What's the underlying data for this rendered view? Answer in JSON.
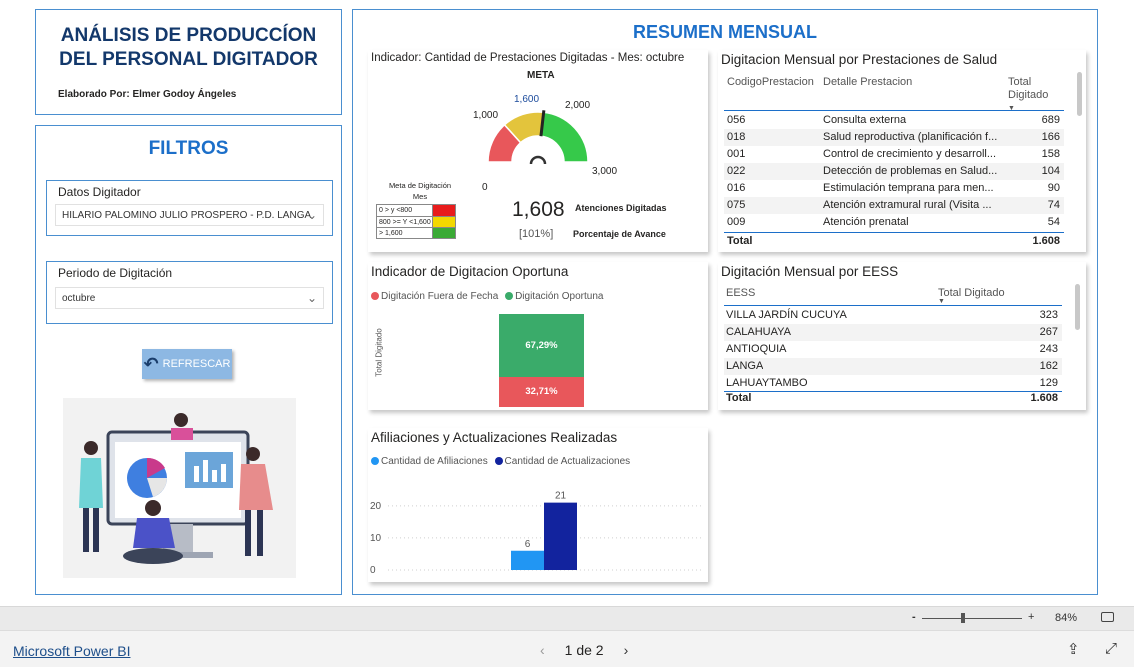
{
  "report": {
    "title_line1": "ANÁLISIS DE PRODUCCÍON",
    "title_line2": "DEL PERSONAL DIGITADOR",
    "author": "Elaborado Por: Elmer Godoy Ángeles"
  },
  "filters": {
    "title": "FILTROS",
    "digitador_label": "Datos Digitador",
    "digitador_value": "HILARIO PALOMINO JULIO PROSPERO - P.D. LANGA",
    "periodo_label": "Periodo de Digitación",
    "periodo_value": "octubre",
    "refresh_label": "REFRESCAR"
  },
  "summary": {
    "title": "RESUMEN MENSUAL"
  },
  "gauge": {
    "title": "Indicador: Cantidad de Prestaciones Digitadas - Mes: octubre",
    "meta_label": "META",
    "target_label": "1,600",
    "tick_min": "0",
    "tick_1000": "1,000",
    "tick_2000": "2,000",
    "tick_max": "3,000",
    "value": 1608,
    "value_label": "1,608",
    "value_caption": "Atenciones Digitadas",
    "percent_label": "[101%]",
    "percent_caption": "Porcentaje de Avance",
    "max": 3000,
    "target": 1600,
    "legend_title": "Meta de Digitación Mes",
    "legend_rows": [
      {
        "label": "0 > y <800",
        "color": "#e81c1c"
      },
      {
        "label": "800 >= Y <1,600",
        "color": "#f2d800"
      },
      {
        "label": "> 1,600",
        "color": "#3aaa35"
      }
    ]
  },
  "prestaciones": {
    "title": "Digitacion Mensual por Prestaciones de Salud",
    "col_code": "CodigoPrestacion",
    "col_detail": "Detalle Prestacion",
    "col_total_1": "Total",
    "col_total_2": "Digitado",
    "rows": [
      {
        "code": "056",
        "detail": "Consulta externa",
        "total": "689"
      },
      {
        "code": "018",
        "detail": "Salud reproductiva (planificación f...",
        "total": "166"
      },
      {
        "code": "001",
        "detail": "Control de crecimiento y desarroll...",
        "total": "158"
      },
      {
        "code": "022",
        "detail": "Detección de problemas en Salud...",
        "total": "104"
      },
      {
        "code": "016",
        "detail": "Estimulación temprana para men...",
        "total": "90"
      },
      {
        "code": "075",
        "detail": "Atención extramural rural (Visita ...",
        "total": "74"
      },
      {
        "code": "009",
        "detail": "Atención prenatal",
        "total": "54"
      }
    ],
    "total_label": "Total",
    "total_value": "1.608"
  },
  "oportuna": {
    "title": "Indicador de Digitacion Oportuna",
    "legend_fuera": "Digitación Fuera de Fecha",
    "legend_oportuna": "Digitación Oportuna",
    "axis_label": "Total Digitado",
    "color_fuera": "#e8575b",
    "color_oportuna": "#3aab6a"
  },
  "eess": {
    "title": "Digitación Mensual por EESS",
    "col_name": "EESS",
    "col_total": "Total Digitado",
    "rows": [
      {
        "name": "VILLA JARDÍN CUCUYA",
        "total": "323"
      },
      {
        "name": "CALAHUAYA",
        "total": "267"
      },
      {
        "name": "ANTIOQUIA",
        "total": "243"
      },
      {
        "name": "LANGA",
        "total": "162"
      },
      {
        "name": "LAHUAYTAMBO",
        "total": "129"
      }
    ],
    "total_label": "Total",
    "total_value": "1.608"
  },
  "chart_data": [
    {
      "type": "bar",
      "title": "Indicador de Digitacion Oportuna",
      "ylabel": "Total Digitado",
      "stacked": "100%",
      "categories": [
        ""
      ],
      "series": [
        {
          "name": "Digitación Fuera de Fecha",
          "values": [
            32.71
          ],
          "label": "32,71%"
        },
        {
          "name": "Digitación Oportuna",
          "values": [
            67.29
          ],
          "label": "67,29%"
        }
      ]
    },
    {
      "type": "bar",
      "title": "Afiliaciones y Actualizaciones Realizadas",
      "categories": [
        ""
      ],
      "ylim": [
        0,
        24
      ],
      "yticks": [
        "0",
        "10",
        "20"
      ],
      "grid": true,
      "series": [
        {
          "name": "Cantidad de Afiliaciones",
          "values": [
            6
          ],
          "color": "#2196f3"
        },
        {
          "name": "Cantidad de Actualizaciones",
          "values": [
            21
          ],
          "color": "#12239e"
        }
      ]
    }
  ],
  "footer": {
    "zoom_minus": "-",
    "zoom_plus": "+",
    "zoom_level": "84%",
    "app_link": "Microsoft Power BI",
    "page_indicator": "1 de 2"
  }
}
